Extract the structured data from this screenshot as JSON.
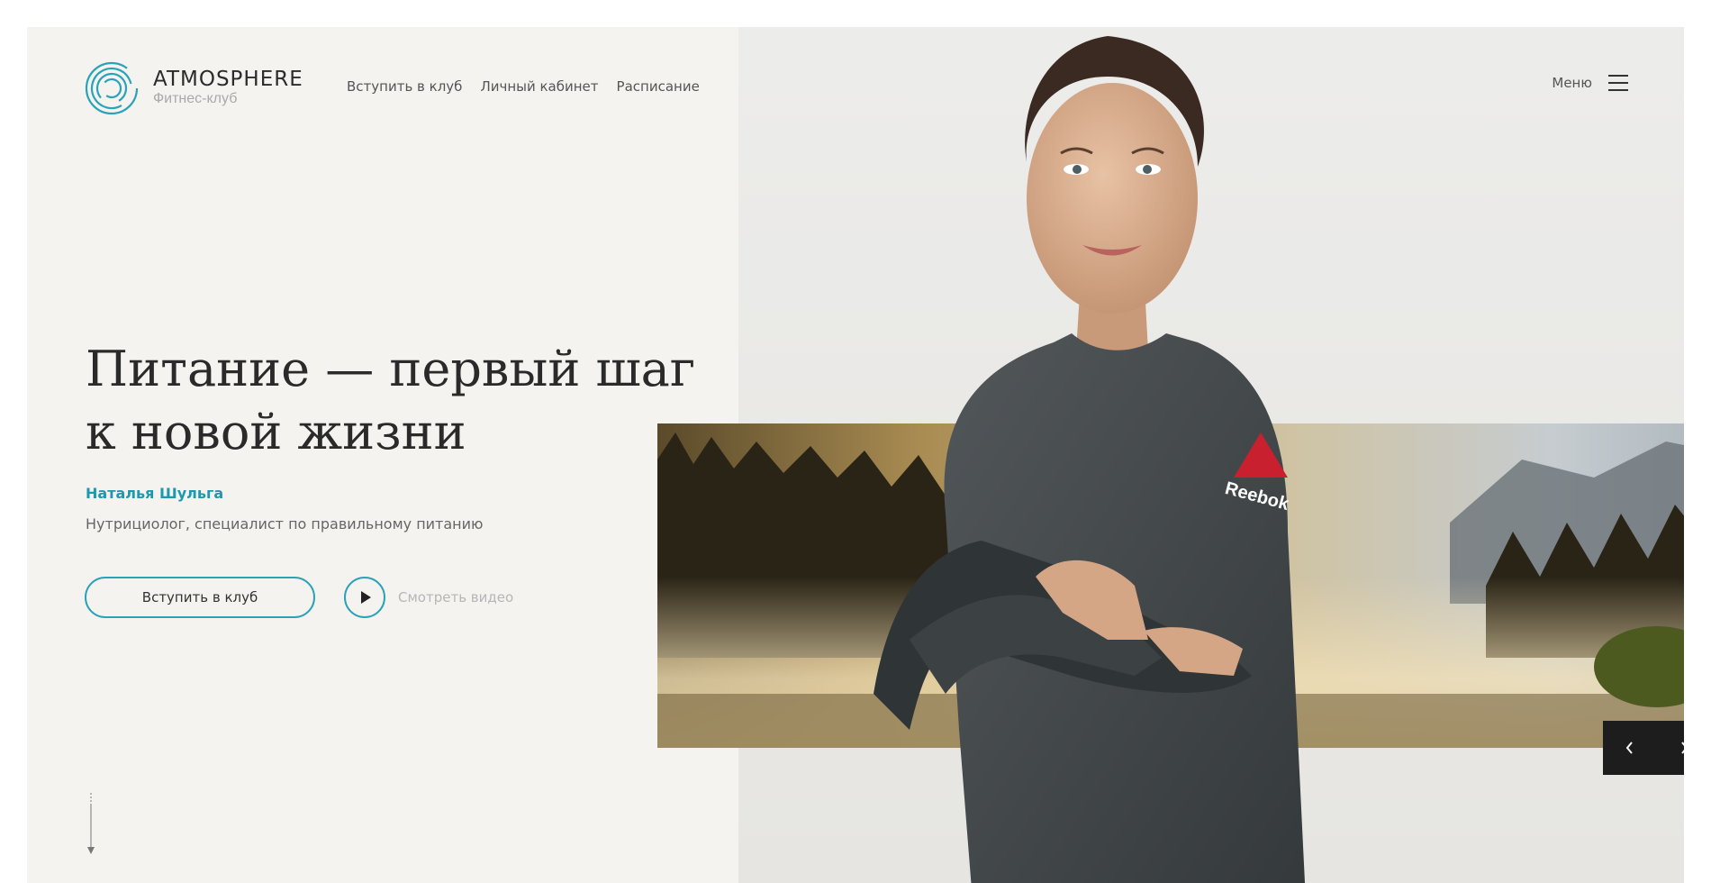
{
  "brand": {
    "name": "ATMOSPHERE",
    "subtitle": "Фитнес-клуб",
    "accent_color": "#2aa3b7"
  },
  "nav": {
    "items": [
      {
        "label": "Вступить в клуб"
      },
      {
        "label": "Личный кабинет"
      },
      {
        "label": "Расписание"
      }
    ]
  },
  "menu": {
    "label": "Меню",
    "icon": "hamburger-menu-icon"
  },
  "hero": {
    "title_line1": "Питание — первый шаг",
    "title_line2": "к новой жизни",
    "author_name": "Наталья Шульга",
    "author_role": "Нутрициолог, специалист по правильному питанию",
    "cta_label": "Вступить в клуб",
    "video_label": "Смотреть видео"
  },
  "photo": {
    "shirt_brand": "Reebok"
  },
  "slider": {
    "prev_icon": "chevron-left-icon",
    "next_icon": "chevron-right-icon"
  }
}
